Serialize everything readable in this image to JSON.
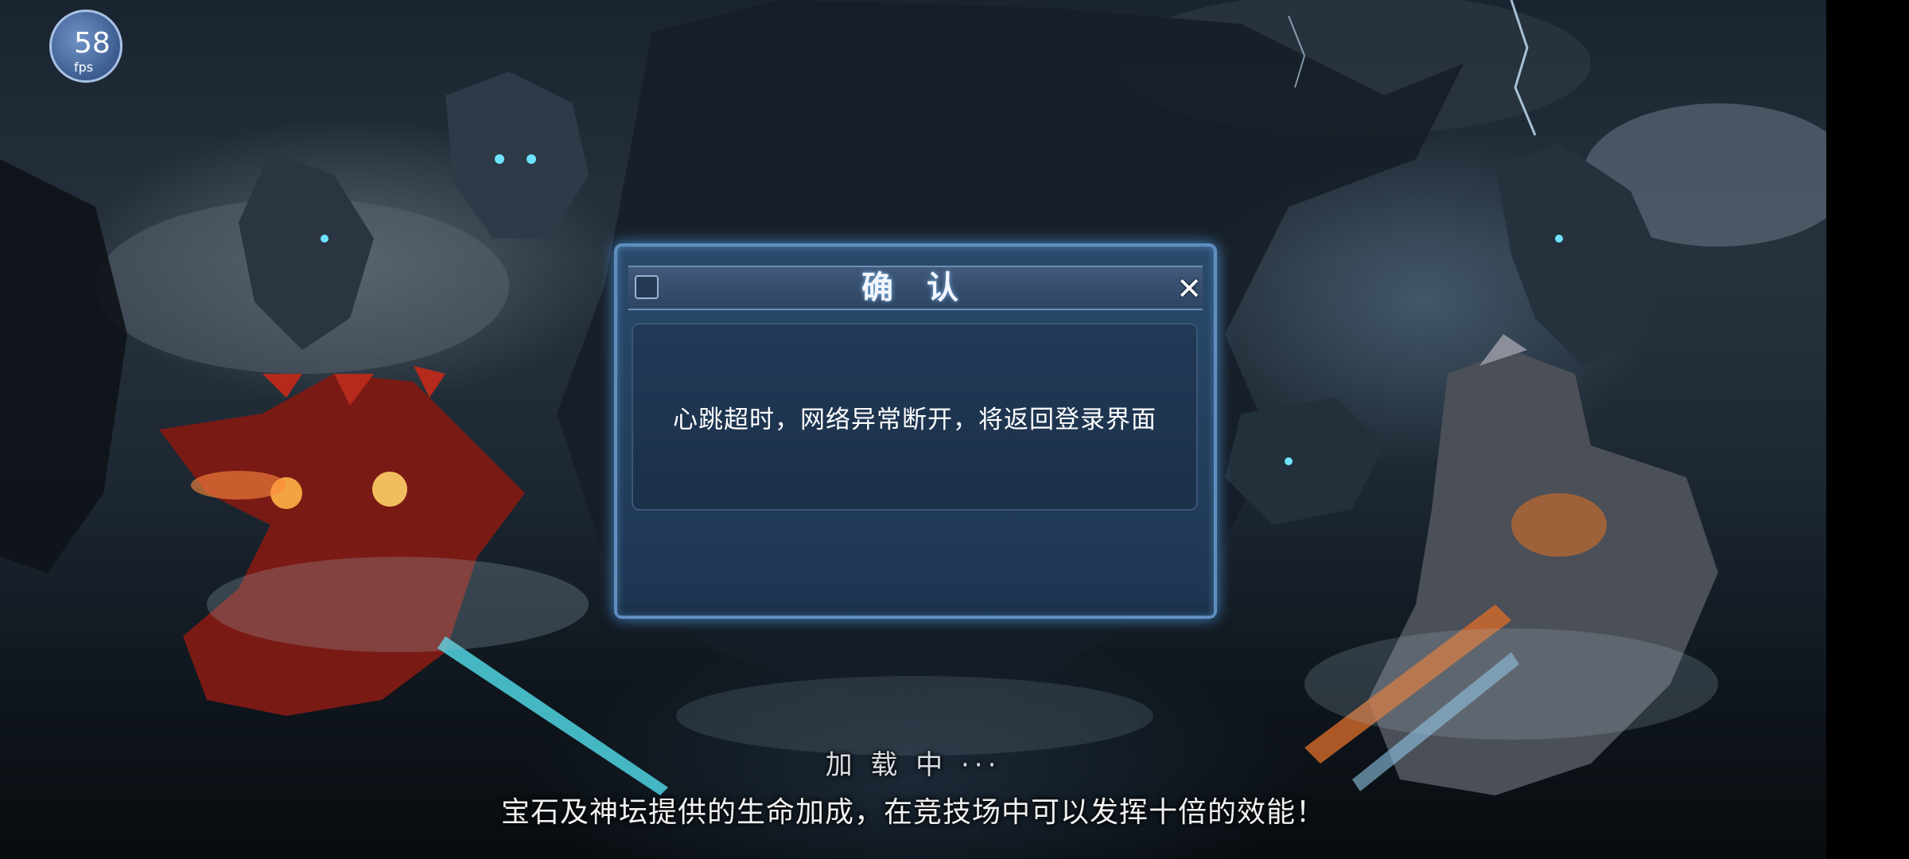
{
  "fps_badge": {
    "value": "58",
    "unit": "fps"
  },
  "dialog": {
    "title": "确 认",
    "close_symbol": "✕",
    "message": "心跳超时，网络异常断开，将返回登录界面"
  },
  "loading": {
    "label": "加 载 中 ···"
  },
  "tip": {
    "text": "宝石及神坛提供的生命加成，在竞技场中可以发挥十倍的效能！"
  },
  "colors": {
    "dialog_border": "#5f8fc0",
    "dialog_bg": "#1d3550",
    "glow": "#5aaaff",
    "text_primary": "#ffffff"
  }
}
